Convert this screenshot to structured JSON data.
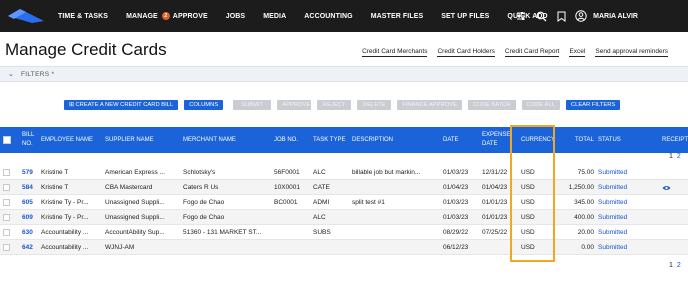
{
  "nav": {
    "items": [
      "TIME & TASKS",
      "MANAGE",
      "APPROVE",
      "JOBS",
      "MEDIA",
      "ACCOUNTING",
      "MASTER FILES",
      "SET UP FILES",
      "QUICK ADD"
    ],
    "approve_badge": "2",
    "user_name": "MARIA ALVIR"
  },
  "page": {
    "title": "Manage Credit Cards",
    "links": [
      "Credit Card Merchants",
      "Credit Card Holders",
      "Credit Card Report",
      "Excel",
      "Send approval reminders"
    ]
  },
  "filters": {
    "label": "FILTERS *"
  },
  "toolbar": {
    "create": "CREATE A NEW CREDIT CARD BILL",
    "columns": "COLUMNS",
    "submit": "SUBMIT",
    "approve": "APPROVE",
    "reject": "REJECT",
    "delete": "DELETE",
    "finance_approve": "FINANCE APPROVE",
    "code_batch": "CODE BATCH",
    "code_all": "CODE ALL",
    "clear_filters": "CLEAR FILTERS"
  },
  "table": {
    "headers": {
      "bill_no": "BILL NO.",
      "employee": "EMPLOYEE NAME",
      "supplier": "SUPPLIER NAME",
      "merchant": "MERCHANT NAME",
      "job": "JOB NO.",
      "task": "TASK TYPE",
      "description": "DESCRIPTION",
      "date": "DATE",
      "expense_date": "EXPENSE DATE",
      "currency": "CURRENCY",
      "total": "TOTAL",
      "status": "STATUS",
      "receipt": "RECEIPT"
    },
    "rows": [
      {
        "bill_no": "579",
        "employee": "Kristine T",
        "supplier": "American Express ...",
        "merchant": "Schlotsky's",
        "job": "56F0001",
        "task": "ALC",
        "description": "billable job but markin...",
        "date": "01/03/23",
        "expense_date": "12/31/22",
        "currency": "USD",
        "total": "75.00",
        "status": "Submitted"
      },
      {
        "bill_no": "584",
        "employee": "Kristine T",
        "supplier": "CBA Mastercard",
        "merchant": "Caters R Us",
        "job": "10X0001",
        "task": "CATE",
        "description": "",
        "date": "01/04/23",
        "expense_date": "01/04/23",
        "currency": "USD",
        "total": "1,250.00",
        "status": "Submitted"
      },
      {
        "bill_no": "605",
        "employee": "Kristine Ty - Pr...",
        "supplier": "Unassigned Suppli...",
        "merchant": "Fogo de Chao",
        "job": "BC0001",
        "task": "ADMI",
        "description": "split test #1",
        "date": "01/03/23",
        "expense_date": "01/01/23",
        "currency": "USD",
        "total": "345.00",
        "status": "Submitted"
      },
      {
        "bill_no": "609",
        "employee": "Kristine Ty - Pr...",
        "supplier": "Unassigned Suppli...",
        "merchant": "Fogo de Chao",
        "job": "",
        "task": "ALC",
        "description": "",
        "date": "01/03/23",
        "expense_date": "01/01/23",
        "currency": "USD",
        "total": "400.00",
        "status": "Submitted"
      },
      {
        "bill_no": "630",
        "employee": "Accountability ...",
        "supplier": "AccountAbility Sup...",
        "merchant": "51360 - 131 MARKET ST...",
        "job": "",
        "task": "SUBS",
        "description": "",
        "date": "08/29/22",
        "expense_date": "07/25/22",
        "currency": "USD",
        "total": "20.00",
        "status": "Submitted"
      },
      {
        "bill_no": "642",
        "employee": "Accountability ...",
        "supplier": "WJNJ-AM",
        "merchant": "",
        "job": "",
        "task": "",
        "description": "",
        "date": "06/12/23",
        "expense_date": "",
        "currency": "USD",
        "total": "0.00",
        "status": "Submitted"
      }
    ]
  },
  "pagination": {
    "current": "1",
    "next": "2"
  }
}
